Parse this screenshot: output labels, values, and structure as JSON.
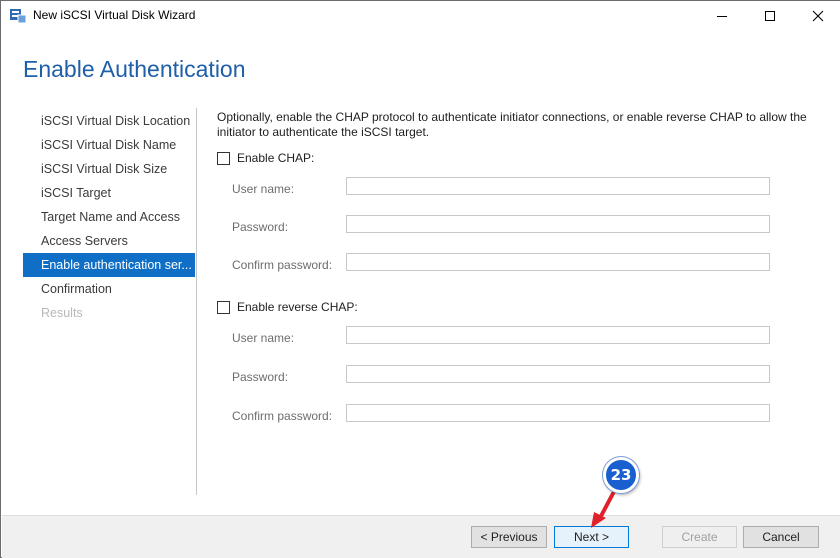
{
  "window": {
    "title": "New iSCSI Virtual Disk Wizard",
    "controls": [
      "minimize",
      "maximize",
      "close"
    ]
  },
  "page": {
    "heading": "Enable Authentication"
  },
  "nav": {
    "items": [
      {
        "label": "iSCSI Virtual Disk Location",
        "state": "normal"
      },
      {
        "label": "iSCSI Virtual Disk Name",
        "state": "normal"
      },
      {
        "label": "iSCSI Virtual Disk Size",
        "state": "normal"
      },
      {
        "label": "iSCSI Target",
        "state": "normal"
      },
      {
        "label": "Target Name and Access",
        "state": "normal"
      },
      {
        "label": "Access Servers",
        "state": "normal"
      },
      {
        "label": "Enable authentication ser...",
        "state": "active"
      },
      {
        "label": "Confirmation",
        "state": "normal"
      },
      {
        "label": "Results",
        "state": "disabled"
      }
    ]
  },
  "main": {
    "description": "Optionally, enable the CHAP protocol to authenticate initiator connections, or enable reverse CHAP to allow the initiator to authenticate the iSCSI target.",
    "chap": {
      "checkbox_label": "Enable CHAP:",
      "checked": false,
      "user_name_label": "User name:",
      "user_name_value": "",
      "password_label": "Password:",
      "password_value": "",
      "confirm_password_label": "Confirm password:",
      "confirm_password_value": ""
    },
    "reverse_chap": {
      "checkbox_label": "Enable reverse CHAP:",
      "checked": false,
      "user_name_label": "User name:",
      "user_name_value": "",
      "password_label": "Password:",
      "password_value": "",
      "confirm_password_label": "Confirm password:",
      "confirm_password_value": ""
    }
  },
  "footer": {
    "previous_label": "< Previous",
    "next_label": "Next >",
    "create_label": "Create",
    "cancel_label": "Cancel"
  },
  "annotation": {
    "step_number": "23",
    "color": "#1a5fd0",
    "arrow_color": "#e0202a"
  }
}
